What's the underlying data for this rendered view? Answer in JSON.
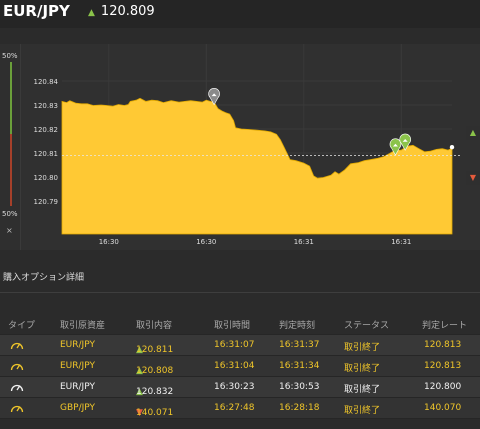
{
  "header": {
    "pair": "EUR/JPY",
    "price": "120.809",
    "trend": "up"
  },
  "chart": {
    "left_labels": {
      "top": "50%",
      "bottom": "50%",
      "close": "×"
    },
    "y_ticks": [
      "120.84",
      "120.83",
      "120.82",
      "120.81",
      "120.80",
      "120.79"
    ],
    "x_ticks": [
      "16:30",
      "16:30",
      "16:31",
      "16:31"
    ],
    "current_rate": 120.809,
    "ylim": [
      120.79,
      120.84
    ],
    "colors": {
      "area": "#ffc934",
      "up": "#8bc34a",
      "down": "#e55b3c",
      "marker_gray": "#8a8a8a"
    },
    "series": [
      [
        0,
        120.8315
      ],
      [
        0.012,
        120.831
      ],
      [
        0.02,
        120.8318
      ],
      [
        0.035,
        120.8308
      ],
      [
        0.05,
        120.8305
      ],
      [
        0.065,
        120.8305
      ],
      [
        0.08,
        120.8298
      ],
      [
        0.1,
        120.83
      ],
      [
        0.115,
        120.8298
      ],
      [
        0.13,
        120.8295
      ],
      [
        0.145,
        120.8302
      ],
      [
        0.16,
        120.8298
      ],
      [
        0.17,
        120.8302
      ],
      [
        0.175,
        120.8315
      ],
      [
        0.19,
        120.832
      ],
      [
        0.2,
        120.8328
      ],
      [
        0.215,
        120.8315
      ],
      [
        0.23,
        120.832
      ],
      [
        0.245,
        120.8318
      ],
      [
        0.26,
        120.831
      ],
      [
        0.28,
        120.8318
      ],
      [
        0.3,
        120.8312
      ],
      [
        0.315,
        120.8315
      ],
      [
        0.33,
        120.8318
      ],
      [
        0.345,
        120.8315
      ],
      [
        0.36,
        120.8312
      ],
      [
        0.37,
        120.832
      ],
      [
        0.38,
        120.8315
      ],
      [
        0.39,
        120.8312
      ],
      [
        0.4,
        120.8285
      ],
      [
        0.41,
        120.8275
      ],
      [
        0.42,
        120.8268
      ],
      [
        0.43,
        120.8262
      ],
      [
        0.44,
        120.8235
      ],
      [
        0.445,
        120.8205
      ],
      [
        0.46,
        120.82
      ],
      [
        0.48,
        120.8198
      ],
      [
        0.5,
        120.8195
      ],
      [
        0.52,
        120.8192
      ],
      [
        0.535,
        120.8188
      ],
      [
        0.55,
        120.8178
      ],
      [
        0.56,
        120.8155
      ],
      [
        0.57,
        120.8122
      ],
      [
        0.585,
        120.8072
      ],
      [
        0.6,
        120.8068
      ],
      [
        0.62,
        120.8058
      ],
      [
        0.635,
        120.8045
      ],
      [
        0.645,
        120.8005
      ],
      [
        0.655,
        120.7995
      ],
      [
        0.67,
        120.7998
      ],
      [
        0.69,
        120.8008
      ],
      [
        0.7,
        120.8022
      ],
      [
        0.71,
        120.8012
      ],
      [
        0.725,
        120.803
      ],
      [
        0.74,
        120.8055
      ],
      [
        0.76,
        120.806
      ],
      [
        0.775,
        120.8068
      ],
      [
        0.79,
        120.8072
      ],
      [
        0.81,
        120.8078
      ],
      [
        0.825,
        120.8085
      ],
      [
        0.84,
        120.8098
      ],
      [
        0.855,
        120.8112
      ],
      [
        0.87,
        120.8112
      ],
      [
        0.885,
        120.8128
      ],
      [
        0.9,
        120.8132
      ],
      [
        0.915,
        120.8118
      ],
      [
        0.93,
        120.8105
      ],
      [
        0.945,
        120.8108
      ],
      [
        0.96,
        120.8115
      ],
      [
        0.975,
        120.8118
      ],
      [
        0.99,
        120.8112
      ],
      [
        1.0,
        120.812
      ]
    ],
    "markers": [
      {
        "x": 0.39,
        "y": 120.8335,
        "kind": "gray"
      },
      {
        "x": 0.855,
        "y": 120.8125,
        "kind": "green"
      },
      {
        "x": 0.88,
        "y": 120.8145,
        "kind": "green"
      }
    ],
    "right_buttons": [
      "up",
      "down"
    ]
  },
  "details": {
    "title": "購入オプション詳細",
    "columns": [
      "タイプ",
      "取引原資産",
      "取引内容",
      "取引時間",
      "判定時刻",
      "ステータス",
      "判定レート"
    ],
    "rows": [
      {
        "type": "gauge",
        "asset": "EUR/JPY",
        "direction": "up",
        "rate": "120.811",
        "time": "16:31:07",
        "judge": "16:31:37",
        "status": "取引終了",
        "judge_rate": "120.813"
      },
      {
        "type": "gauge",
        "asset": "EUR/JPY",
        "direction": "up",
        "rate": "120.808",
        "time": "16:31:04",
        "judge": "16:31:34",
        "status": "取引終了",
        "judge_rate": "120.813"
      },
      {
        "type": "gauge",
        "asset": "EUR/JPY",
        "direction": "up",
        "rate": "120.832",
        "time": "16:30:23",
        "judge": "16:30:53",
        "status": "取引終了",
        "judge_rate": "120.800"
      },
      {
        "type": "gauge",
        "asset": "GBP/JPY",
        "direction": "down",
        "rate": "140.071",
        "time": "16:27:48",
        "judge": "16:28:18",
        "status": "取引終了",
        "judge_rate": "140.070"
      }
    ]
  }
}
